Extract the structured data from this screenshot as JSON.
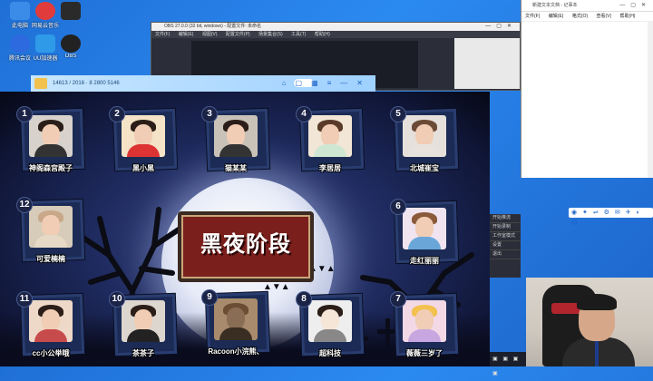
{
  "desktop": {
    "icons": [
      {
        "label": "此电脑",
        "color": "#3b8be8"
      },
      {
        "label": "网易云音乐",
        "color": "#e23b3b"
      },
      {
        "label": "",
        "color": "#2a2a2a"
      },
      {
        "label": "腾讯会议",
        "color": "#2d6ae0"
      },
      {
        "label": "UU加速器",
        "color": "#2f9ae8"
      },
      {
        "label": "OBS",
        "color": "#222"
      },
      {
        "label": "",
        "color": "#f2c14e"
      }
    ]
  },
  "obs": {
    "title": "OBS 27.0.0 (32 bit, windows) - 配置文件: 未命名",
    "menu": [
      "文件(F)",
      "编辑(E)",
      "视图(V)",
      "配置文件(P)",
      "场景集合(S)",
      "工具(T)",
      "帮助(H)"
    ],
    "controls": [
      "开始推流",
      "开始录制",
      "工作室模式",
      "设置",
      "退出"
    ]
  },
  "notepad": {
    "title": "新建文本文档 - 记事本",
    "menu": [
      "文件(F)",
      "编辑(E)",
      "格式(O)",
      "查看(V)",
      "帮助(H)"
    ]
  },
  "tray": {
    "icons": "◉ ✦ ⇌ ⚙ ✉ ✈ ◐ ▤"
  },
  "taskbar": {
    "icons": "▣ ▣ ▣ ▣"
  },
  "app": {
    "window_title": "14613 / 2016 · 8 2800 5146",
    "window_buttons": [
      "⌂",
      "▢",
      "▦",
      "≡",
      "—",
      "✕"
    ]
  },
  "game": {
    "phase_title": "黑夜阶段",
    "players": [
      {
        "num": "1",
        "name": "神阁森宫殿子",
        "photo": "#d8d2cc"
      },
      {
        "num": "2",
        "name": "黑小黑",
        "photo": "#f4e3c6"
      },
      {
        "num": "3",
        "name": "猫某某",
        "photo": "#c9c2b8"
      },
      {
        "num": "4",
        "name": "李居居",
        "photo": "#f2e6d6"
      },
      {
        "num": "5",
        "name": "北城崔宝",
        "photo": "#e6e0dc"
      },
      {
        "num": "12",
        "name": "可爱楠楠",
        "photo": "#d7cbb9"
      },
      {
        "num": "6",
        "name": "走红丽丽",
        "photo": "#f0e4f0"
      },
      {
        "num": "11",
        "name": "cc小公举哦",
        "photo": "#eed8c8"
      },
      {
        "num": "10",
        "name": "茶茶子",
        "photo": "#dcd6cf"
      },
      {
        "num": "9",
        "name": "Racoon小浣熊、",
        "photo": "#a88b6c"
      },
      {
        "num": "8",
        "name": "超科技",
        "photo": "#eeeeee"
      },
      {
        "num": "7",
        "name": "薇薇三岁了",
        "photo": "#f3d8e6"
      }
    ]
  }
}
